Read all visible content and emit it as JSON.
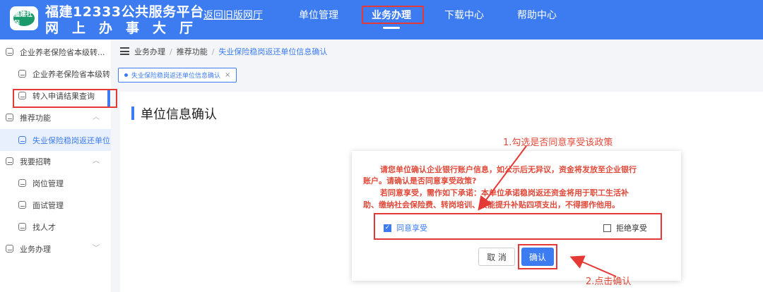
{
  "header": {
    "logo_text": "福建社保",
    "brand_line1": "福建12333公共服务平台",
    "brand_line2": "网上办事大厅",
    "nav": [
      "返回旧版网厅",
      "单位管理",
      "业务办理",
      "下载中心",
      "帮助中心"
    ]
  },
  "sidebar": {
    "items": [
      {
        "label": "企业养老保险省本级转..."
      },
      {
        "label": "企业养老保险省本级转"
      },
      {
        "label": "转入申请结果查询"
      },
      {
        "label": "推荐功能"
      },
      {
        "label": "失业保险稳岗返还单位"
      },
      {
        "label": "我要招聘"
      },
      {
        "label": "岗位管理"
      },
      {
        "label": "面试管理"
      },
      {
        "label": "找人才"
      },
      {
        "label": "业务办理"
      }
    ]
  },
  "breadcrumb": {
    "items": [
      "业务办理",
      "推荐功能",
      "失业保险稳岗返还单位信息确认"
    ]
  },
  "tag": {
    "label": "失业保险稳岗返还单位信息确认",
    "close": "×"
  },
  "page": {
    "title": "单位信息确认"
  },
  "dialog": {
    "msg_line1": "请您单位确认企业银行账户信息，如公示后无异议，资金将发放至企业银行",
    "msg_line2": "账户。请确认是否同意享受政策?",
    "msg_line3": "若同意享受，需作如下承诺：本单位承诺稳岗返还资金将用于职工生活补",
    "msg_line4": "助、缴纳社会保险费、转岗培训、技能提升补贴四项支出，不得挪作他用。",
    "agree_label": "同意享受",
    "refuse_label": "拒绝享受",
    "cancel_label": "取 消",
    "ok_label": "确认"
  },
  "annotations": {
    "step1": "1.勾选是否同意享受该政策",
    "step2": "2.点击确认"
  },
  "colors": {
    "primary": "#3d7cf0",
    "annotation_red": "#e53935",
    "message_red": "#e04a3a"
  }
}
